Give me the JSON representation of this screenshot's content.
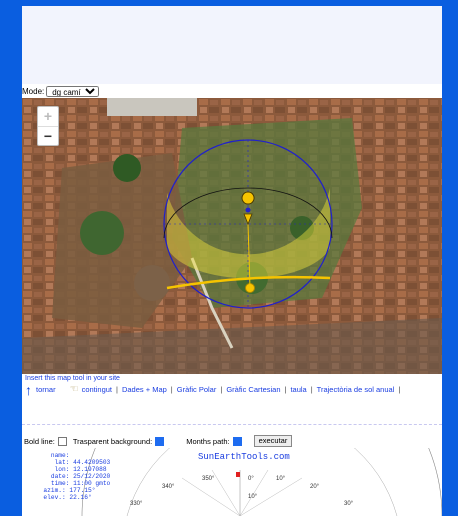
{
  "mode": {
    "label": "Mode:",
    "selected": "dg camí"
  },
  "links": {
    "insert": "Insert this map tool in your site",
    "nav": [
      {
        "id": "tornar",
        "label": "tornar"
      },
      {
        "id": "contingut",
        "label": "contingut"
      },
      {
        "id": "dades",
        "label": "Dades + Map"
      },
      {
        "id": "polar",
        "label": "Gràfic Polar"
      },
      {
        "id": "cartesian",
        "label": "Gràfic Cartesian"
      },
      {
        "id": "taula",
        "label": "taula"
      },
      {
        "id": "trajectoria",
        "label": "Trajectòria de sol anual"
      }
    ]
  },
  "controls": {
    "bold_line": "Bold line:",
    "transparent": "Trasparent background:",
    "months": "Months path:",
    "execute": "executar"
  },
  "info": {
    "lines": [
      "    name:",
      "     lat: 44.4209503",
      "     lon: 12.197088",
      "    date: 25/12/2020",
      "    time: 11:00 gmto",
      "  azim.: 177.15°",
      "  elev.: 22.16°"
    ]
  },
  "brand": "SunEarthTools.com",
  "polar_labels": [
    "350°",
    "0°",
    "10°",
    "340°",
    "20°",
    "330°",
    "30°",
    "10°"
  ],
  "colors": {
    "page_bg": "#0a5ee0",
    "link": "#1a3de0",
    "sun": "#f6c400",
    "path": "#2020cc"
  }
}
